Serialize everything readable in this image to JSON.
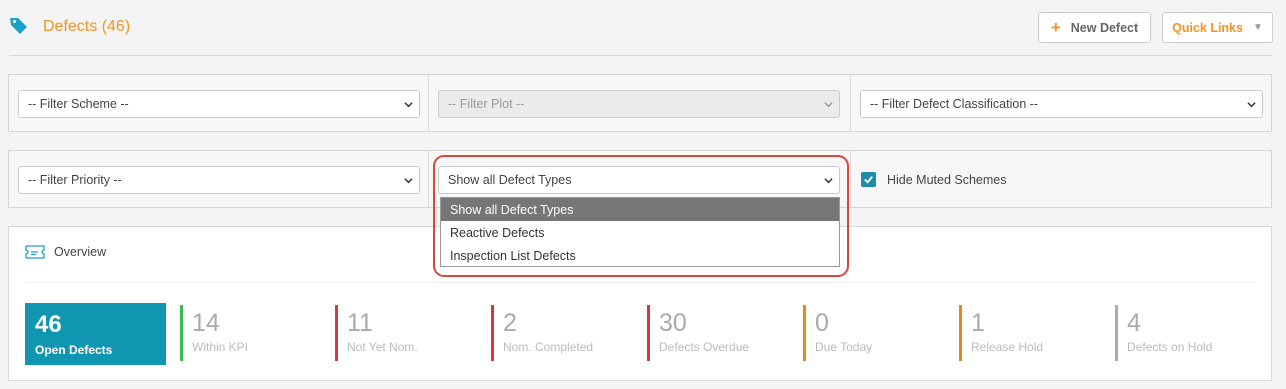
{
  "header": {
    "title": "Defects (46)",
    "new_defect_label": "New Defect",
    "quick_links_label": "Quick Links"
  },
  "filters": {
    "scheme": "-- Filter Scheme --",
    "plot": "-- Filter Plot --",
    "classification": "-- Filter Defect Classification --",
    "priority": "-- Filter Priority --",
    "defect_type": "Show all Defect Types",
    "hide_muted_label": "Hide Muted Schemes",
    "hide_muted_checked": true
  },
  "defect_type_options": [
    "Show all Defect Types",
    "Reactive Defects",
    "Inspection List Defects"
  ],
  "overview": {
    "title": "Overview",
    "main_stat": {
      "value": "46",
      "label": "Open Defects"
    },
    "stats": [
      {
        "value": "14",
        "label": "Within KPI",
        "color": "#3cba54"
      },
      {
        "value": "11",
        "label": "Not Yet Nom.",
        "color": "#d9363e"
      },
      {
        "value": "2",
        "label": "Nom. Completed",
        "color": "#d9363e"
      },
      {
        "value": "30",
        "label": "Defects Overdue",
        "color": "#d9363e"
      },
      {
        "value": "0",
        "label": "Due Today",
        "color": "#e08a1e"
      },
      {
        "value": "1",
        "label": "Release Hold",
        "color": "#e08a1e"
      },
      {
        "value": "4",
        "label": "Defects on Hold",
        "color": "#a3adb8"
      }
    ]
  },
  "colors": {
    "accent_orange": "#f39323",
    "accent_teal": "#1196b2",
    "highlight_red": "#d9473c"
  }
}
